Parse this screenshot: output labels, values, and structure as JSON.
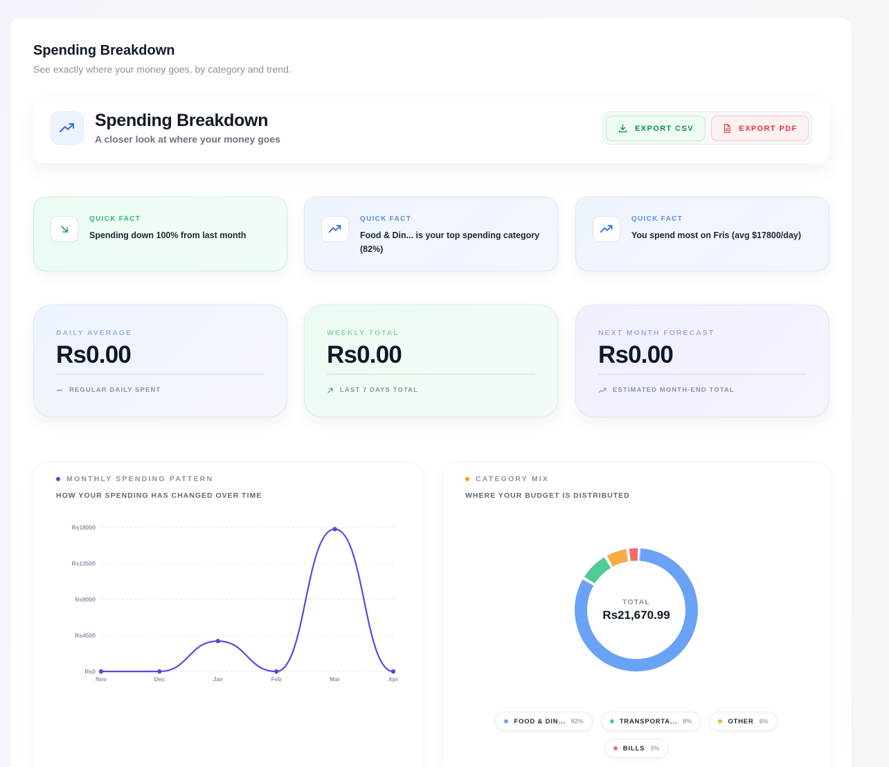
{
  "page": {
    "title": "Spending Breakdown",
    "subtitle": "See exactly where your money goes, by category and trend."
  },
  "hero": {
    "icon": "trending-up-icon",
    "title": "Spending Breakdown",
    "subtitle": "A closer look at where your money goes",
    "export_csv": "EXPORT CSV",
    "export_pdf": "EXPORT PDF"
  },
  "facts": [
    {
      "label": "QUICK FACT",
      "text": "Spending down 100% from last month",
      "icon": "trending-down-icon"
    },
    {
      "label": "QUICK FACT",
      "text": "Food & Din... is your top spending category (82%)",
      "icon": "trending-up-icon"
    },
    {
      "label": "QUICK FACT",
      "text": "You spend most on Fris (avg $17800/day)",
      "icon": "trending-up-icon"
    }
  ],
  "stats": [
    {
      "label": "DAILY AVERAGE",
      "value": "Rs0.00",
      "foot": "REGULAR DAILY SPENT",
      "icon": "minus-icon"
    },
    {
      "label": "WEEKLY TOTAL",
      "value": "Rs0.00",
      "foot": "LAST 7 DAYS TOTAL",
      "icon": "arrow-up-right-icon"
    },
    {
      "label": "NEXT MONTH FORECAST",
      "value": "Rs0.00",
      "foot": "ESTIMATED MONTH-END TOTAL",
      "icon": "trending-up-icon"
    }
  ],
  "monthly": {
    "title": "MONTHLY SPENDING PATTERN",
    "subtitle": "HOW YOUR SPENDING HAS CHANGED OVER TIME"
  },
  "category": {
    "title": "CATEGORY MIX",
    "subtitle": "WHERE YOUR BUDGET IS DISTRIBUTED",
    "total_label": "TOTAL",
    "total_value": "Rs21,670.99"
  },
  "colors": {
    "line": "#5b47db",
    "food": "#6aa2f5",
    "transport": "#4fcb93",
    "other": "#f7ad45",
    "bills": "#f06b6b",
    "extra1": "#a99af1",
    "extra2": "#9fc0f7"
  },
  "chart_data": [
    {
      "type": "line",
      "x": [
        "Nov",
        "Dec",
        "Jan",
        "Feb",
        "Mar",
        "Apr"
      ],
      "series": [
        {
          "values": [
            0,
            0,
            3800,
            0,
            17800,
            0
          ]
        }
      ],
      "yticks": [
        "Rs0",
        "Rs4500",
        "Rs9000",
        "Rs13500",
        "Rs18000"
      ],
      "ylim": [
        0,
        18000
      ],
      "grid": true
    },
    {
      "type": "pie",
      "categories": [
        "FOOD & DIN...",
        "TRANSPORTA...",
        "OTHER",
        "BILLS"
      ],
      "values": [
        82,
        8,
        6,
        3
      ],
      "labels": [
        "82%",
        "8%",
        "6%",
        "3%"
      ]
    }
  ]
}
